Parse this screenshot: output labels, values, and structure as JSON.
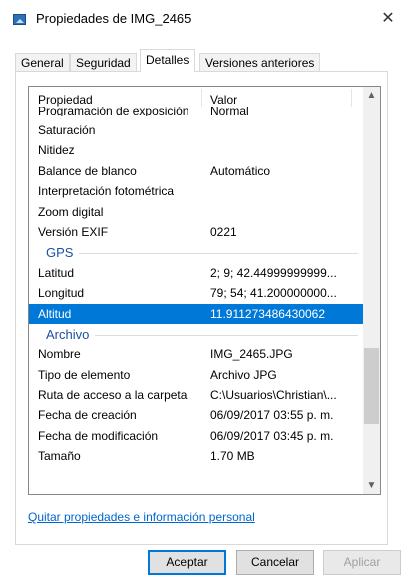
{
  "window": {
    "title": "Propiedades de IMG_2465",
    "close_glyph": "✕"
  },
  "tabs": [
    {
      "label": "General"
    },
    {
      "label": "Seguridad"
    },
    {
      "label": "Detalles",
      "active": true
    },
    {
      "label": "Versiones anteriores"
    }
  ],
  "list": {
    "headers": {
      "property": "Propiedad",
      "value": "Valor"
    },
    "top_partial": {
      "key": "Programación de exposición",
      "value": "Normal"
    },
    "rows_a": [
      {
        "key": "Saturación",
        "value": ""
      },
      {
        "key": "Nitidez",
        "value": ""
      },
      {
        "key": "Balance de blanco",
        "value": "Automático"
      },
      {
        "key": "Interpretación fotométrica",
        "value": ""
      },
      {
        "key": "Zoom digital",
        "value": ""
      },
      {
        "key": "Versión EXIF",
        "value": "0221"
      }
    ],
    "group_gps": "GPS",
    "rows_gps": [
      {
        "key": "Latitud",
        "value": "2; 9; 42.44999999999..."
      },
      {
        "key": "Longitud",
        "value": "79; 54; 41.200000000..."
      },
      {
        "key": "Altitud",
        "value": "11.911273486430062",
        "selected": true
      }
    ],
    "group_archivo": "Archivo",
    "rows_archivo": [
      {
        "key": "Nombre",
        "value": "IMG_2465.JPG"
      },
      {
        "key": "Tipo de elemento",
        "value": "Archivo JPG"
      },
      {
        "key": "Ruta de acceso a la carpeta",
        "value": "C:\\Usuarios\\Christian\\..."
      },
      {
        "key": "Fecha de creación",
        "value": "06/09/2017 03:55 p. m."
      },
      {
        "key": "Fecha de modificación",
        "value": "06/09/2017 03:45 p. m."
      },
      {
        "key": "Tamaño",
        "value": "1.70 MB"
      }
    ],
    "scroll_up_glyph": "▲",
    "scroll_down_glyph": "▼"
  },
  "remove_link": "Quitar propiedades e información personal",
  "buttons": {
    "ok": "Aceptar",
    "cancel": "Cancelar",
    "apply": "Aplicar"
  }
}
